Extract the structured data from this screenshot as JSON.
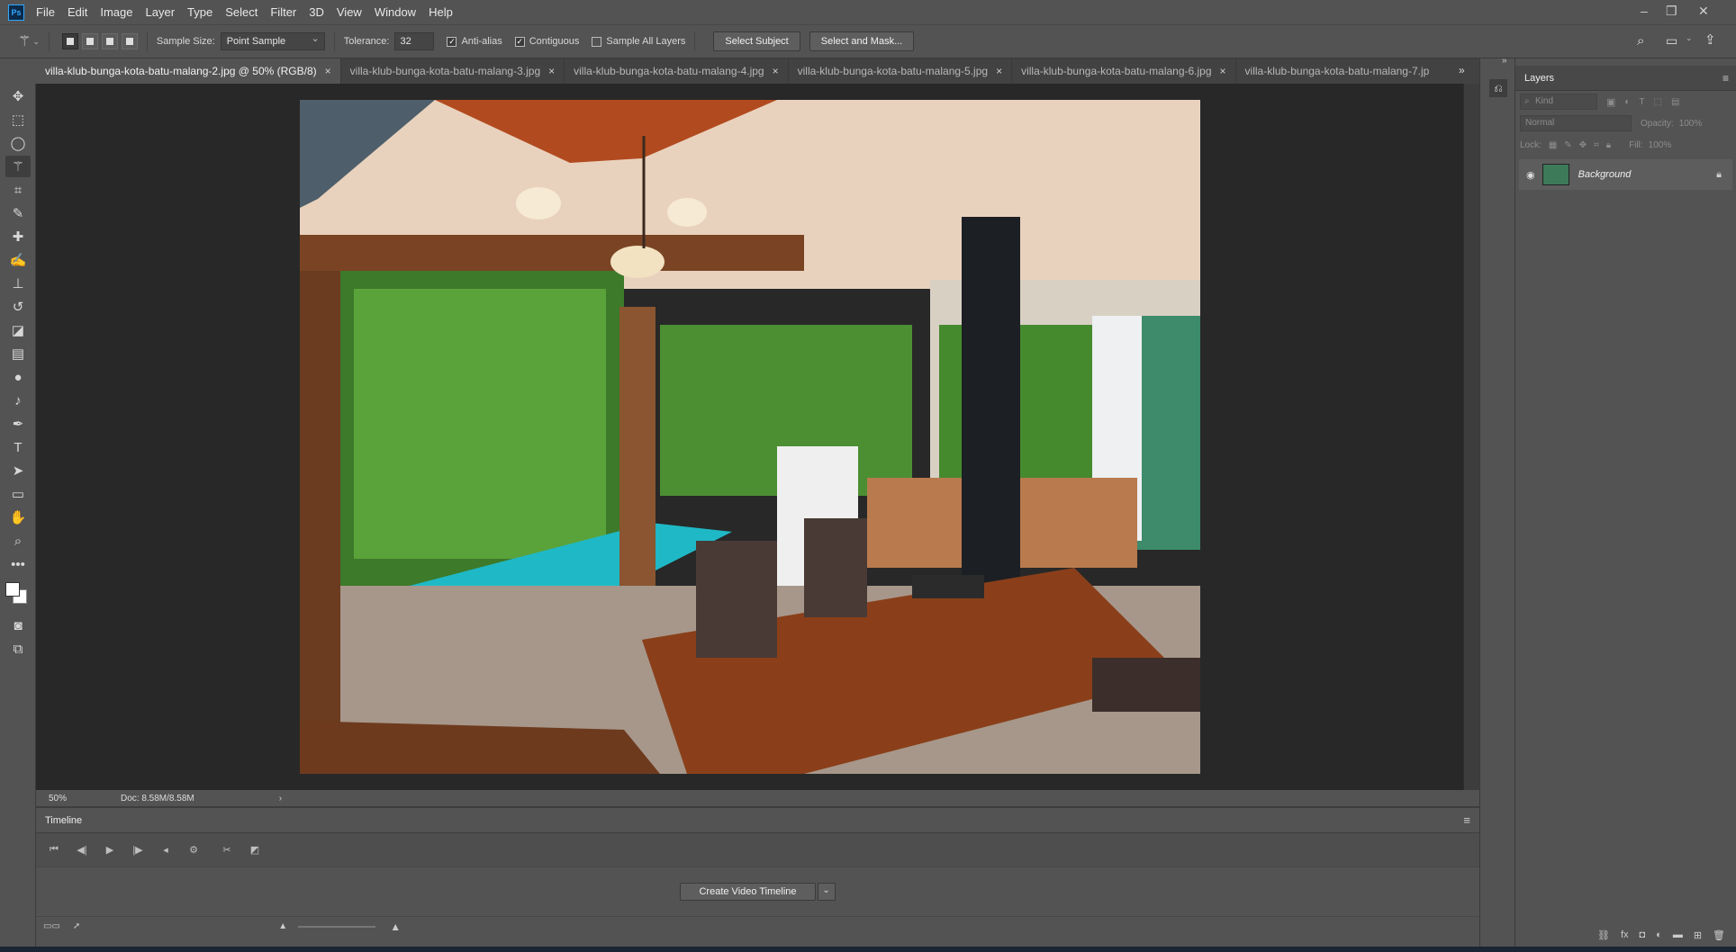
{
  "app": {
    "name": "Photoshop",
    "logo_text": "Ps"
  },
  "menu": [
    "File",
    "Edit",
    "Image",
    "Layer",
    "Type",
    "Select",
    "Filter",
    "3D",
    "View",
    "Window",
    "Help"
  ],
  "options": {
    "sample_size_label": "Sample Size:",
    "sample_size_value": "Point Sample",
    "tolerance_label": "Tolerance:",
    "tolerance_value": "32",
    "anti_alias": "Anti-alias",
    "contiguous": "Contiguous",
    "sample_all_layers": "Sample All Layers",
    "select_subject": "Select Subject",
    "select_and_mask": "Select and Mask..."
  },
  "tabs": [
    {
      "label": "villa-klub-bunga-kota-batu-malang-2.jpg @ 50% (RGB/8)",
      "active": true
    },
    {
      "label": "villa-klub-bunga-kota-batu-malang-3.jpg",
      "active": false
    },
    {
      "label": "villa-klub-bunga-kota-batu-malang-4.jpg",
      "active": false
    },
    {
      "label": "villa-klub-bunga-kota-batu-malang-5.jpg",
      "active": false
    },
    {
      "label": "villa-klub-bunga-kota-batu-malang-6.jpg",
      "active": false
    },
    {
      "label": "villa-klub-bunga-kota-batu-malang-7.jp",
      "active": false
    }
  ],
  "tab_close": "×",
  "status": {
    "zoom": "50%",
    "doc": "Doc: 8.58M/8.58M"
  },
  "timeline": {
    "title": "Timeline",
    "create_button": "Create Video Timeline"
  },
  "layers": {
    "title": "Layers",
    "kind": "Kind",
    "blend_mode": "Normal",
    "opacity_label": "Opacity:",
    "opacity_value": "100%",
    "lock_label": "Lock:",
    "fill_label": "Fill:",
    "fill_value": "100%",
    "layer_name": "Background"
  },
  "colors": {
    "accent": "#31a8ff",
    "panel": "#535353",
    "canvas": "#282828"
  }
}
